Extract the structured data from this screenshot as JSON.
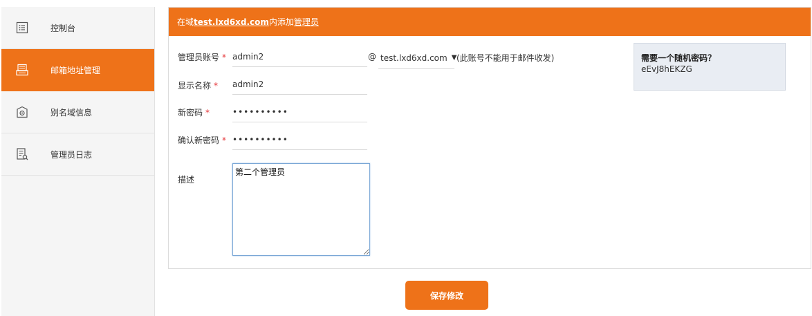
{
  "sidebar": {
    "items": [
      {
        "label": "控制台",
        "icon": "dashboard-icon",
        "active": false
      },
      {
        "label": "邮箱地址管理",
        "icon": "mailbox-icon",
        "active": true
      },
      {
        "label": "别名域信息",
        "icon": "alias-domain-icon",
        "active": false
      },
      {
        "label": "管理员日志",
        "icon": "admin-log-icon",
        "active": false
      }
    ]
  },
  "header": {
    "prefix": "在域",
    "domain": "test.lxd6xd.com",
    "middle": "内添加",
    "link": "管理员"
  },
  "form": {
    "account": {
      "label": "管理员账号",
      "required": "*",
      "value": "admin2"
    },
    "at": "@",
    "domain_select": {
      "value": "test.lxd6xd.com",
      "arrow": "▼"
    },
    "note": "(此账号不能用于邮件收发)",
    "display_name": {
      "label": "显示名称",
      "required": "*",
      "value": "admin2"
    },
    "new_password": {
      "label": "新密码",
      "required": "*",
      "value": "••••••••••"
    },
    "confirm_password": {
      "label": "确认新密码",
      "required": "*",
      "value": "••••••••••"
    },
    "description": {
      "label": "描述",
      "value": "第二个管理员"
    }
  },
  "random_password": {
    "title": "需要一个随机密码？",
    "password": "eEvJ8hEKZG"
  },
  "actions": {
    "save_label": "保存修改"
  },
  "colors": {
    "accent": "#ee7219",
    "required": "#e5363a",
    "info_box": "#e9edf3"
  }
}
